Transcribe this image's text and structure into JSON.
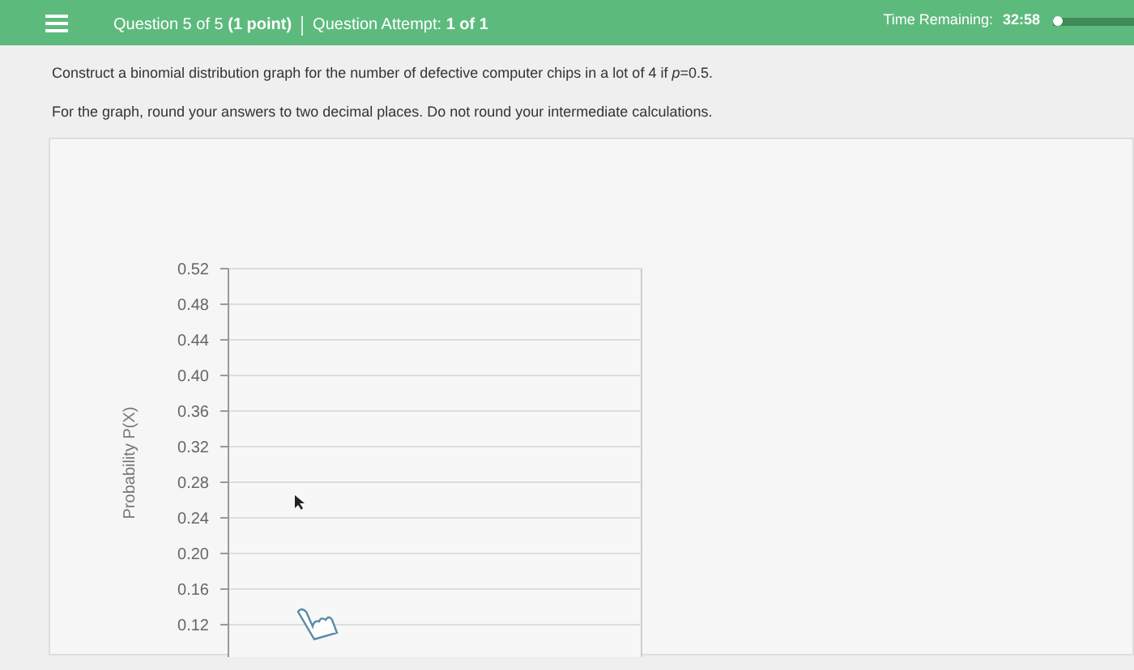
{
  "header": {
    "question": "Question 5 of 5 **(1 point)**",
    "attempt": "Question Attempt: **1 of 1**",
    "time_label": "Time Remaining:",
    "time_value": "32:58",
    "progress": {
      "level": 0.05
    }
  },
  "instructions": [
    "Construct a binomial distribution graph for the number of defective computer chips in a lot of 4 if *p*=0.5.",
    "For the graph, round your answers to two decimal places. Do not round your intermediate calculations."
  ],
  "graph": {
    "y_axis_title": "Probability P(X)",
    "y_tick_labels": [
      "0.52",
      "0.48",
      "0.44",
      "0.40",
      "0.36",
      "0.32",
      "0.28",
      "0.24",
      "0.20",
      "0.16",
      "0.12"
    ]
  }
}
